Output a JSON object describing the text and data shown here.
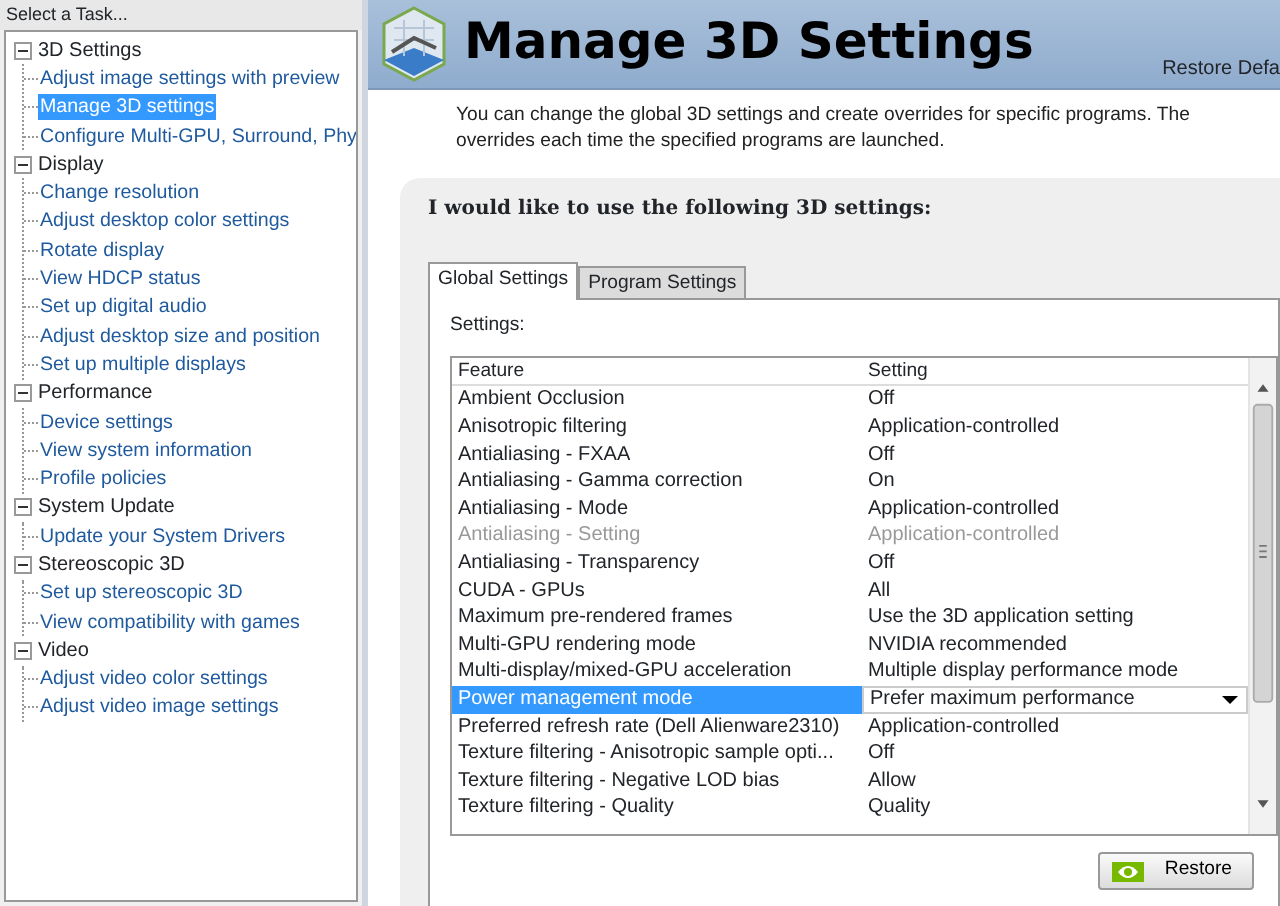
{
  "sidebar": {
    "title": "Select a Task...",
    "groups": [
      {
        "label": "3D Settings",
        "expanded": true,
        "items": [
          {
            "label": "Adjust image settings with preview",
            "selected": false
          },
          {
            "label": "Manage 3D settings",
            "selected": true
          },
          {
            "label": "Configure Multi-GPU, Surround, Phy",
            "selected": false
          }
        ]
      },
      {
        "label": "Display",
        "expanded": true,
        "items": [
          {
            "label": "Change resolution",
            "selected": false
          },
          {
            "label": "Adjust desktop color settings",
            "selected": false
          },
          {
            "label": "Rotate display",
            "selected": false
          },
          {
            "label": "View HDCP status",
            "selected": false
          },
          {
            "label": "Set up digital audio",
            "selected": false
          },
          {
            "label": "Adjust desktop size and position",
            "selected": false
          },
          {
            "label": "Set up multiple displays",
            "selected": false
          }
        ]
      },
      {
        "label": "Performance",
        "expanded": true,
        "items": [
          {
            "label": "Device settings",
            "selected": false
          },
          {
            "label": "View system information",
            "selected": false
          },
          {
            "label": "Profile policies",
            "selected": false
          }
        ]
      },
      {
        "label": "System Update",
        "expanded": true,
        "items": [
          {
            "label": "Update your System Drivers",
            "selected": false
          }
        ]
      },
      {
        "label": "Stereoscopic 3D",
        "expanded": true,
        "items": [
          {
            "label": "Set up stereoscopic 3D",
            "selected": false
          },
          {
            "label": "View compatibility with games",
            "selected": false
          }
        ]
      },
      {
        "label": "Video",
        "expanded": true,
        "items": [
          {
            "label": "Adjust video color settings",
            "selected": false
          },
          {
            "label": "Adjust video image settings",
            "selected": false
          }
        ]
      }
    ]
  },
  "header": {
    "title": "Manage 3D Settings",
    "restore_link": "Restore Defa"
  },
  "description": "You can change the global 3D settings and create overrides for specific programs. The overrides each time the specified programs are launched.",
  "panel": {
    "heading": "I would like to use the following 3D settings:",
    "tabs": [
      {
        "label": "Global Settings",
        "selected": true
      },
      {
        "label": "Program Settings",
        "selected": false
      }
    ],
    "settings_label": "Settings:",
    "table": {
      "columns": [
        "Feature",
        "Setting"
      ],
      "rows": [
        {
          "feature": "Ambient Occlusion",
          "setting": "Off",
          "selected": false,
          "disabled": false
        },
        {
          "feature": "Anisotropic filtering",
          "setting": "Application-controlled",
          "selected": false,
          "disabled": false
        },
        {
          "feature": "Antialiasing - FXAA",
          "setting": "Off",
          "selected": false,
          "disabled": false
        },
        {
          "feature": "Antialiasing - Gamma correction",
          "setting": "On",
          "selected": false,
          "disabled": false
        },
        {
          "feature": "Antialiasing - Mode",
          "setting": "Application-controlled",
          "selected": false,
          "disabled": false
        },
        {
          "feature": "Antialiasing - Setting",
          "setting": "Application-controlled",
          "selected": false,
          "disabled": true
        },
        {
          "feature": "Antialiasing - Transparency",
          "setting": "Off",
          "selected": false,
          "disabled": false
        },
        {
          "feature": "CUDA - GPUs",
          "setting": "All",
          "selected": false,
          "disabled": false
        },
        {
          "feature": "Maximum pre-rendered frames",
          "setting": "Use the 3D application setting",
          "selected": false,
          "disabled": false
        },
        {
          "feature": "Multi-GPU rendering mode",
          "setting": "NVIDIA recommended",
          "selected": false,
          "disabled": false
        },
        {
          "feature": "Multi-display/mixed-GPU acceleration",
          "setting": "Multiple display performance mode",
          "selected": false,
          "disabled": false
        },
        {
          "feature": "Power management mode",
          "setting": "Prefer maximum performance",
          "selected": true,
          "disabled": false
        },
        {
          "feature": "Preferred refresh rate (Dell Alienware2310)",
          "setting": "Application-controlled",
          "selected": false,
          "disabled": false
        },
        {
          "feature": "Texture filtering - Anisotropic sample opti...",
          "setting": "Off",
          "selected": false,
          "disabled": false
        },
        {
          "feature": "Texture filtering - Negative LOD bias",
          "setting": "Allow",
          "selected": false,
          "disabled": false
        },
        {
          "feature": "Texture filtering - Quality",
          "setting": "Quality",
          "selected": false,
          "disabled": false
        }
      ]
    },
    "restore_button": "Restore"
  }
}
